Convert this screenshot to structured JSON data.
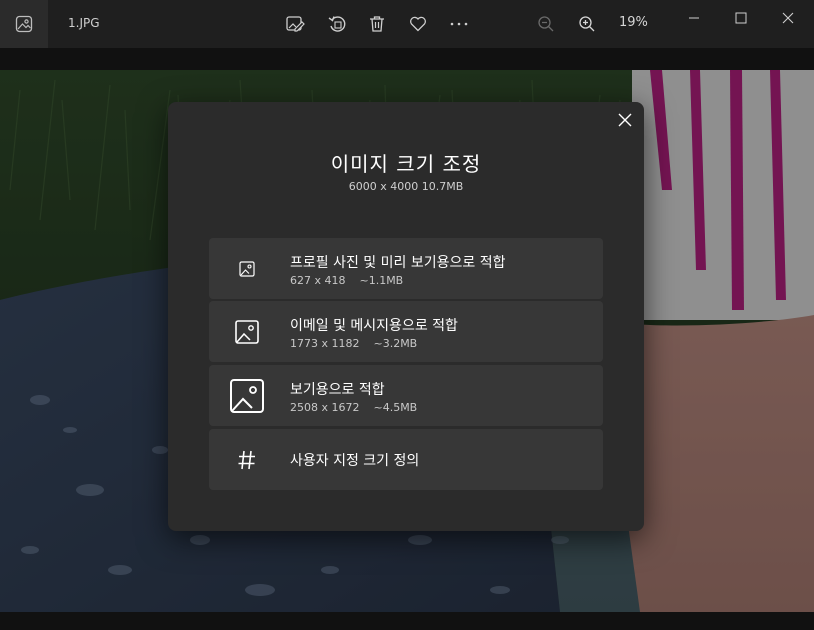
{
  "titlebar": {
    "file_name": "1.JPG",
    "zoom_level": "19%",
    "toolbar_icons": [
      "edit-image-icon",
      "rotate-icon",
      "delete-icon",
      "favorite-icon",
      "more-icon",
      "zoom-out-icon",
      "zoom-in-icon"
    ],
    "window_icons": [
      "minimize-icon",
      "maximize-icon",
      "close-icon"
    ]
  },
  "dialog": {
    "title": "이미지 크기 조정",
    "subtitle": "6000 x 4000   10.7MB",
    "options": [
      {
        "label": "프로필 사진 및 미리 보기용으로 적합",
        "meta": "627 x 418    ~1.1MB",
        "icon": "image-small-icon"
      },
      {
        "label": "이메일 및 메시지용으로 적합",
        "meta": "1773 x 1182    ~3.2MB",
        "icon": "image-medium-icon"
      },
      {
        "label": "보기용으로 적합",
        "meta": "2508 x 1672    ~4.5MB",
        "icon": "image-large-icon"
      },
      {
        "label": "사용자 지정 크기 정의",
        "icon": "hash-icon"
      }
    ]
  },
  "colors": {
    "titlebar_bg": "#1f1f1f",
    "dialog_bg": "#2b2b2b",
    "option_bg": "#373737",
    "accent_stripe": "#b3207f"
  }
}
